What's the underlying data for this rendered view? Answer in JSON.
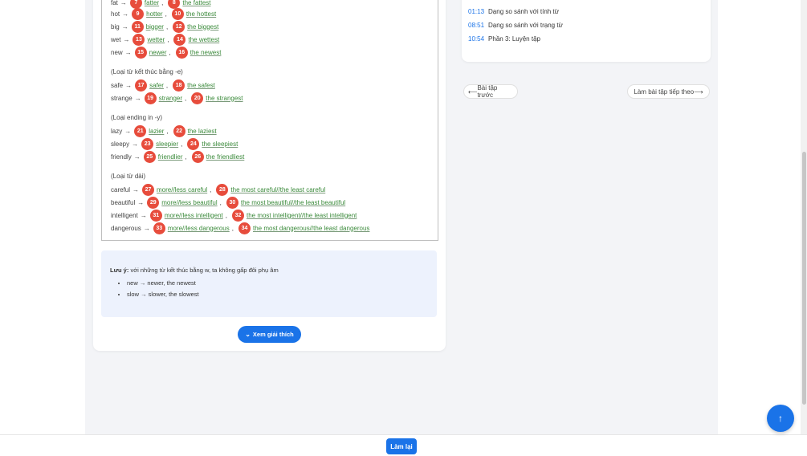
{
  "exercise": {
    "rows": [
      {
        "word": "fat",
        "n1": "7",
        "a1": "fatter",
        "n2": "8",
        "a2": "the fattest"
      },
      {
        "word": "hot",
        "n1": "9",
        "a1": "hotter",
        "n2": "10",
        "a2": "the hottest"
      },
      {
        "word": "big",
        "n1": "11",
        "a1": "bigger",
        "n2": "12",
        "a2": "the biggest"
      },
      {
        "word": "wet",
        "n1": "13",
        "a1": "wetter",
        "n2": "14",
        "a2": "the wettest"
      },
      {
        "word": "new",
        "n1": "15",
        "a1": "newer",
        "n2": "16",
        "a2": "the newest"
      },
      {
        "word": "safe",
        "n1": "17",
        "a1": "safer",
        "n2": "18",
        "a2": "the safest"
      },
      {
        "word": "strange",
        "n1": "19",
        "a1": "stranger",
        "n2": "20",
        "a2": "the strangest"
      },
      {
        "word": "lazy",
        "n1": "21",
        "a1": "lazier",
        "n2": "22",
        "a2": "the laziest"
      },
      {
        "word": "sleepy",
        "n1": "23",
        "a1": "sleepier",
        "n2": "24",
        "a2": "the sleepiest"
      },
      {
        "word": "friendly",
        "n1": "25",
        "a1": "friendlier",
        "n2": "26",
        "a2": "the friendliest"
      },
      {
        "word": "careful",
        "n1": "27",
        "a1": "more//less careful",
        "n2": "28",
        "a2": "the most careful//the least careful"
      },
      {
        "word": "beautiful",
        "n1": "29",
        "a1": "more//less beautiful",
        "n2": "30",
        "a2": "the most beautiful//the least beautiful"
      },
      {
        "word": "intelligent",
        "n1": "31",
        "a1": "more//less intelligent",
        "n2": "32",
        "a2": "the most intelligent//the least intelligent"
      },
      {
        "word": "dangerous",
        "n1": "33",
        "a1": "more//less dangerous",
        "n2": "34",
        "a2": "the most dangerous//the least dangerous"
      }
    ],
    "heading_e": "(Loại từ kết thúc bằng -e)",
    "heading_y": "(Loại ending in -y)",
    "heading_long": "(Loại từ dài)",
    "arrow": "→",
    "comma": ","
  },
  "note": {
    "label": "Lưu ý:",
    "text": "với những từ kết thúc bằng w, ta không gấp đôi phụ âm",
    "items": [
      "new → newer, the newest",
      "slow → slower, the slowest"
    ]
  },
  "explain_button": "Xem giải thích",
  "toc": [
    {
      "time": "01:13",
      "title": "Dạng so sánh với tính từ"
    },
    {
      "time": "08:51",
      "title": "Dạng so sánh với trạng từ"
    },
    {
      "time": "10:54",
      "title": "Phần 3: Luyện tập"
    }
  ],
  "nav": {
    "prev": "Bài tập trước",
    "next": "Làm bài tập tiếp theo"
  },
  "footer": {
    "retry": "Làm lại"
  },
  "colors": {
    "accent": "#1a73e8",
    "badge": "#e74c3c",
    "answer": "#3a8a3a"
  }
}
